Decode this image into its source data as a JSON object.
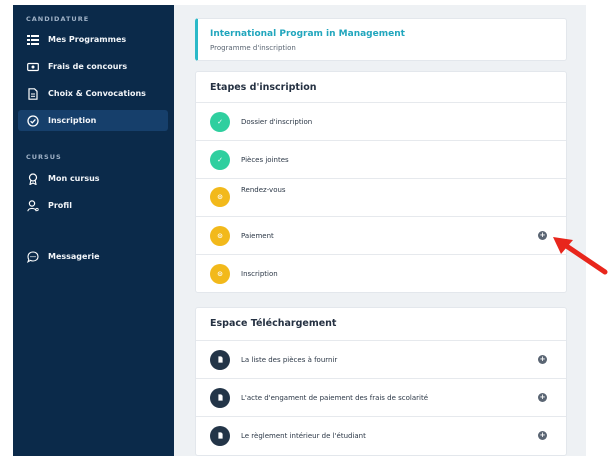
{
  "sidebar": {
    "sections": [
      {
        "label": "CANDIDATURE"
      },
      {
        "label": "CURSUS"
      }
    ],
    "items": [
      {
        "label": "Mes Programmes",
        "icon": "list-icon"
      },
      {
        "label": "Frais de concours",
        "icon": "money-icon"
      },
      {
        "label": "Choix & Convocations",
        "icon": "document-icon"
      },
      {
        "label": "Inscription",
        "icon": "check-circle-icon",
        "active": true
      },
      {
        "label": "Mon cursus",
        "icon": "award-icon"
      },
      {
        "label": "Profil",
        "icon": "user-icon"
      },
      {
        "label": "Messagerie",
        "icon": "chat-icon"
      }
    ]
  },
  "program": {
    "title": "International Program in Management",
    "subtitle": "Programme d'inscription"
  },
  "steps": {
    "title": "Etapes d'inscription",
    "items": [
      {
        "label": "Dossier d'inscription",
        "status": "done",
        "symbol": "✓"
      },
      {
        "label": "Pièces jointes",
        "status": "done",
        "symbol": "✓"
      },
      {
        "label": "Rendez-vous",
        "status": "pending",
        "symbol": "⊙"
      },
      {
        "label": "Paiement",
        "status": "pending",
        "symbol": "⊙"
      },
      {
        "label": "Inscription",
        "status": "pending",
        "symbol": "⊙"
      }
    ]
  },
  "downloads": {
    "title": "Espace Téléchargement",
    "items": [
      {
        "label": "La liste des pièces à fournir"
      },
      {
        "label": "L'acte d'engament de paiement des frais de scolarité"
      },
      {
        "label": "Le règlement intérieur de l'étudiant"
      }
    ]
  },
  "colors": {
    "sidebar_bg": "#0b2a4a",
    "accent_teal": "#2bb9c8",
    "done_green": "#2fcf9f",
    "pending_yellow": "#f2b91b",
    "arrow_red": "#e8261c"
  }
}
